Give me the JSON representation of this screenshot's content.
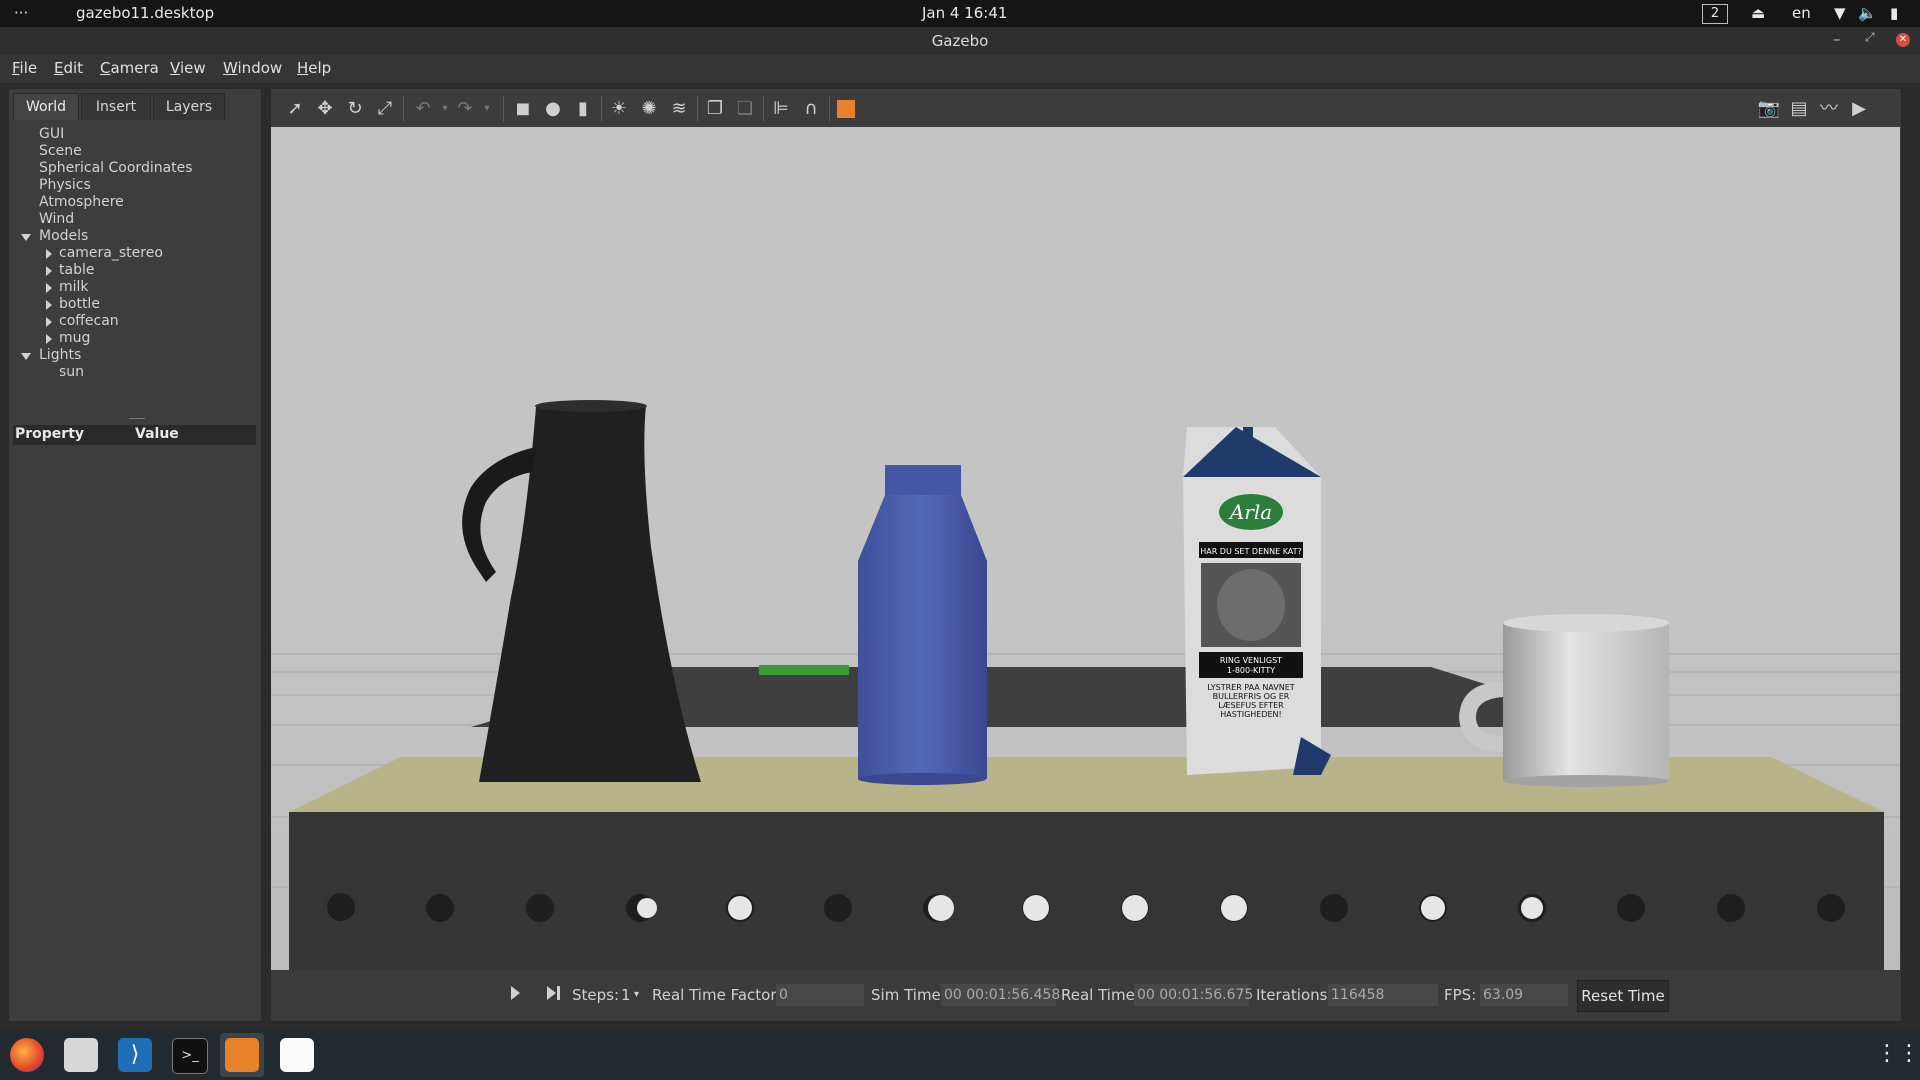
{
  "topbar": {
    "menu_dots": "···",
    "app_name": "gazebo11.desktop",
    "datetime": "Jan 4  16:41",
    "workspace": "2",
    "language": "en"
  },
  "window": {
    "title": "Gazebo"
  },
  "menu": [
    "File",
    "Edit",
    "Camera",
    "View",
    "Window",
    "Help"
  ],
  "left_panel": {
    "tabs": [
      "World",
      "Insert",
      "Layers"
    ],
    "tree": {
      "top": [
        "GUI",
        "Scene",
        "Spherical Coordinates",
        "Physics",
        "Atmosphere",
        "Wind"
      ],
      "models_label": "Models",
      "models": [
        "camera_stereo",
        "table",
        "milk",
        "bottle",
        "coffecan",
        "mug"
      ],
      "lights_label": "Lights",
      "lights": [
        "sun"
      ]
    },
    "property_header": {
      "property": "Property",
      "value": "Value"
    }
  },
  "scene": {
    "carton_brand": "Arla",
    "carton_line1": "HAR DU SET DENNE KAT?",
    "carton_line2": "RING VENLIGST",
    "carton_line3": "1-800-KITTY",
    "carton_text": "LYSTRER PAA NAVNET BULLERFRIS OG ER LÆSEFUS EFTER HASTIGHEDEN!"
  },
  "bottom": {
    "steps_label": "Steps:",
    "steps_value": "1",
    "rtf_label": "Real Time Factor:",
    "rtf_value": "0",
    "sim_time_label": "Sim Time:",
    "sim_time_value": "00 00:01:56.458",
    "real_time_label": "Real Time:",
    "real_time_value": "00 00:01:56.675",
    "iterations_label": "Iterations:",
    "iterations_value": "116458",
    "fps_label": "FPS:",
    "fps_value": "63.09",
    "reset_label": "Reset Time"
  },
  "colors": {
    "window_bg": "#3d3d3d",
    "viewport_sky": "#c4c4c4",
    "bottle_blue": "#4a5ba8",
    "table_top": "#b8b48a",
    "toolbar_orange": "#e8822a"
  },
  "dock": {
    "icons": [
      "firefox-icon",
      "files-icon",
      "vscode-icon",
      "terminal-icon",
      "gazebo-icon",
      "screenshot-icon",
      "app-grid-icon"
    ]
  }
}
